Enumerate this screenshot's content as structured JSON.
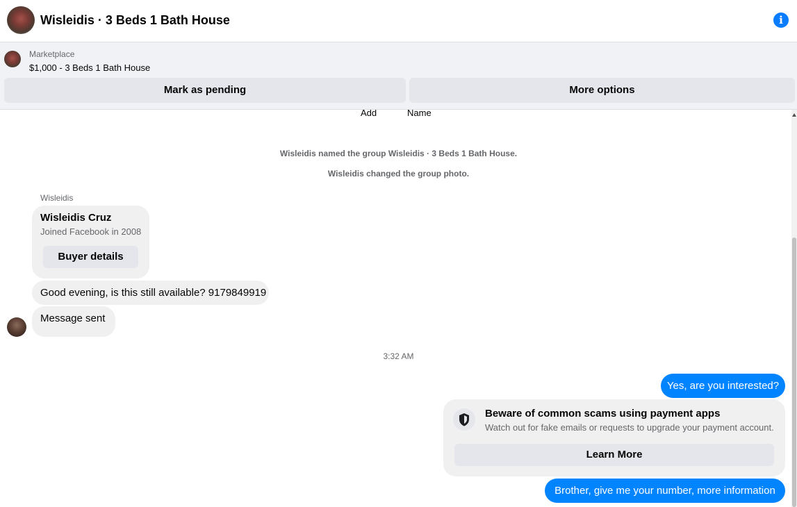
{
  "header": {
    "title": "Wisleidis · 3 Beds 1 Bath House",
    "info_icon": "info-icon",
    "info_glyph": "i"
  },
  "marketplace": {
    "label": "Marketplace",
    "listing": "$1,000 - 3 Beds 1 Bath House",
    "mark_pending_label": "Mark as pending",
    "more_options_label": "More options"
  },
  "chat": {
    "cut_labels": [
      "Add",
      "Name"
    ],
    "system_messages": [
      "Wisleidis named the group Wisleidis · 3 Beds 1 Bath House.",
      "Wisleidis changed the group photo."
    ],
    "sender_name": "Wisleidis",
    "buyer_card": {
      "name": "Wisleidis Cruz",
      "joined": "Joined Facebook in 2008",
      "button_label": "Buyer details"
    },
    "incoming": [
      "Good evening, is this still available? 9179849919",
      "Message sent"
    ],
    "timestamp": "3:32 AM",
    "outgoing": [
      "Yes, are you interested?",
      "Brother, give me your number, more information"
    ],
    "scam_warning": {
      "icon": "shield-icon",
      "title": "Beware of common scams using payment apps",
      "body": "Watch out for fake emails or requests to upgrade your payment account.",
      "button_label": "Learn More"
    }
  },
  "colors": {
    "accent": "#0084ff",
    "info": "#0a7cff",
    "incoming_bubble": "#f0f0f0",
    "button_bg": "#e4e6eb",
    "secondary_text": "#65676b"
  }
}
